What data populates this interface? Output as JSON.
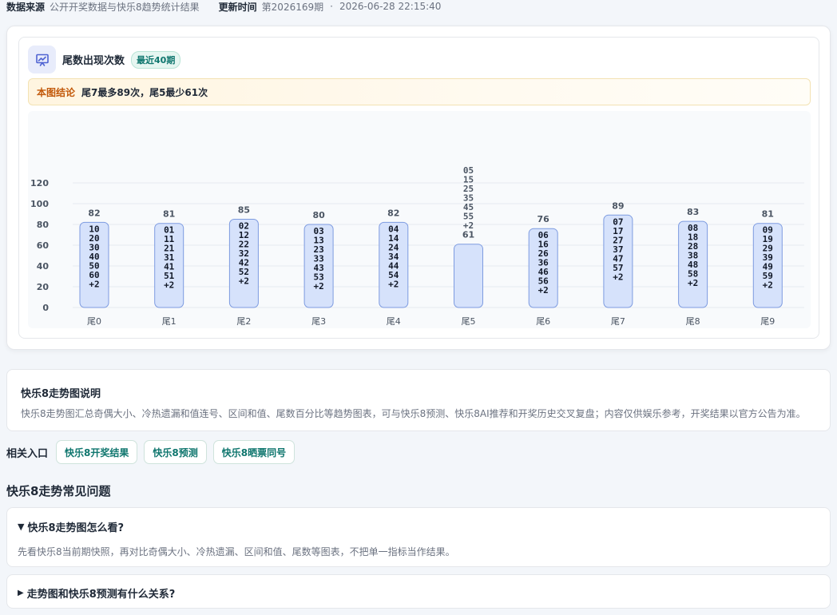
{
  "meta": {
    "source_label": "数据来源",
    "source_value": "公开开奖数据与快乐8趋势统计结果",
    "update_label": "更新时间",
    "issue": "第2026169期",
    "dot": "·",
    "datetime": "2026-06-28 22:15:40"
  },
  "card": {
    "title": "尾数出现次数",
    "badge": "最近40期",
    "conclusion_tag": "本图结论",
    "conclusion_text": "尾7最多89次，尾5最少61次"
  },
  "chart_data": {
    "type": "bar",
    "ylim": [
      0,
      120
    ],
    "yticks": [
      0,
      20,
      40,
      60,
      80,
      100,
      120
    ],
    "grid": true,
    "categories": [
      "尾0",
      "尾1",
      "尾2",
      "尾3",
      "尾4",
      "尾5",
      "尾6",
      "尾7",
      "尾8",
      "尾9"
    ],
    "values": [
      82,
      81,
      85,
      80,
      82,
      61,
      76,
      89,
      83,
      81
    ],
    "bar_labels": [
      [
        "10",
        "20",
        "30",
        "40",
        "50",
        "60",
        "+2"
      ],
      [
        "01",
        "11",
        "21",
        "31",
        "41",
        "51",
        "+2"
      ],
      [
        "02",
        "12",
        "22",
        "32",
        "42",
        "52",
        "+2"
      ],
      [
        "03",
        "13",
        "23",
        "33",
        "43",
        "53",
        "+2"
      ],
      [
        "04",
        "14",
        "24",
        "34",
        "44",
        "54",
        "+2"
      ],
      [
        "05",
        "15",
        "25",
        "35",
        "45",
        "55",
        "+2"
      ],
      [
        "06",
        "16",
        "26",
        "36",
        "46",
        "56",
        "+2"
      ],
      [
        "07",
        "17",
        "27",
        "37",
        "47",
        "57",
        "+2"
      ],
      [
        "08",
        "18",
        "28",
        "38",
        "48",
        "58",
        "+2"
      ],
      [
        "09",
        "19",
        "29",
        "39",
        "49",
        "59",
        "+2"
      ]
    ],
    "colors": {
      "bar_fill": "#d6e2fb",
      "bar_stroke": "#7d9be0",
      "grid": "#e6eaf0",
      "label": "#4b5563",
      "inner_label": "#111827"
    }
  },
  "description": {
    "title": "快乐8走势图说明",
    "body": "快乐8走势图汇总奇偶大小、冷热遗漏和值连号、区间和值、尾数百分比等趋势图表，可与快乐8预测、快乐8AI推荐和开奖历史交叉复盘；内容仅供娱乐参考，开奖结果以官方公告为准。"
  },
  "related": {
    "label": "相关入口",
    "links": [
      "快乐8开奖结果",
      "快乐8预测",
      "快乐8晒票同号"
    ]
  },
  "faq": {
    "title": "快乐8走势常见问题",
    "items": [
      {
        "marker": "▼",
        "question": "快乐8走势图怎么看?",
        "answer": "先看快乐8当前期快照，再对比奇偶大小、冷热遗漏、区间和值、尾数等图表，不把单一指标当作结果。"
      },
      {
        "marker": "▶",
        "question": "走势图和快乐8预测有什么关系?",
        "answer": ""
      }
    ]
  }
}
